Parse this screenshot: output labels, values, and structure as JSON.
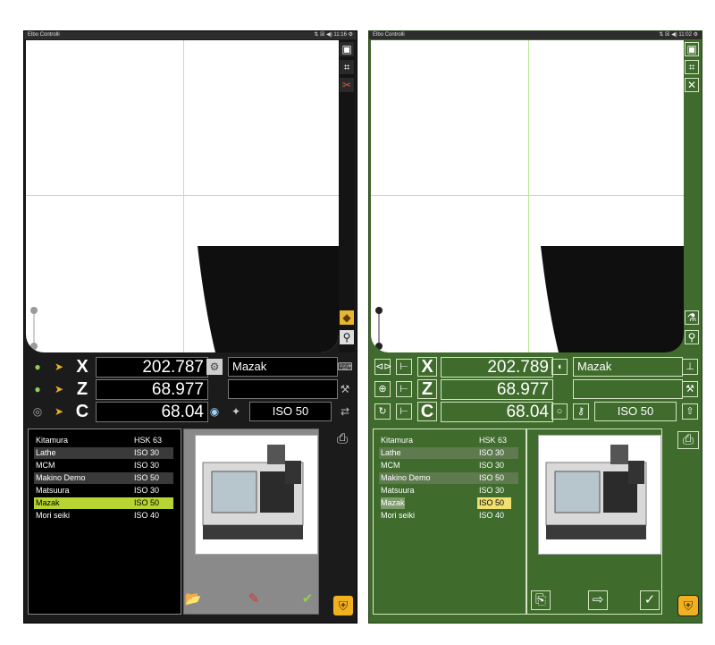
{
  "colors": {
    "accent_a": "#b8d432",
    "accent_b": "#f0e070",
    "panel_a": "#1b1b1b",
    "panel_b": "#3f6b2d"
  },
  "panels": [
    {
      "window_title": "Elbo Controlli",
      "status_time": "11:16",
      "x_value": "202.787",
      "z_value": "68.977",
      "c_value": "68.04",
      "machine_name": "Mazak",
      "spindle": "ISO 50",
      "selected_index": 5,
      "machines": [
        {
          "name": "Kitamura",
          "spindle": "HSK 63"
        },
        {
          "name": "Lathe",
          "spindle": "ISO 30"
        },
        {
          "name": "MCM",
          "spindle": "ISO 30"
        },
        {
          "name": "Makino Demo",
          "spindle": "ISO 50"
        },
        {
          "name": "Matsuura",
          "spindle": "ISO 30"
        },
        {
          "name": "Mazak",
          "spindle": "ISO 50"
        },
        {
          "name": "Mori seiki",
          "spindle": "ISO 40"
        }
      ]
    },
    {
      "window_title": "Elbo Controlli",
      "status_time": "11:02",
      "x_value": "202.789",
      "z_value": "68.977",
      "c_value": "68.04",
      "machine_name": "Mazak",
      "spindle": "ISO 50",
      "selected_index": 5,
      "machines": [
        {
          "name": "Kitamura",
          "spindle": "HSK 63"
        },
        {
          "name": "Lathe",
          "spindle": "ISO 30"
        },
        {
          "name": "MCM",
          "spindle": "ISO 30"
        },
        {
          "name": "Makino Demo",
          "spindle": "ISO 50"
        },
        {
          "name": "Matsuura",
          "spindle": "ISO 30"
        },
        {
          "name": "Mazak",
          "spindle": "ISO 50"
        },
        {
          "name": "Mori seiki",
          "spindle": "ISO 40"
        }
      ]
    }
  ],
  "axis_letters": {
    "x": "X",
    "z": "Z",
    "c": "C"
  },
  "icons": {
    "print": "printer-icon",
    "save": "folder-icon",
    "edit": "edit-icon",
    "ok": "checkmark-icon",
    "badge": "shield-badge-icon",
    "cut": "scissors-icon",
    "crop": "crop-icon"
  }
}
